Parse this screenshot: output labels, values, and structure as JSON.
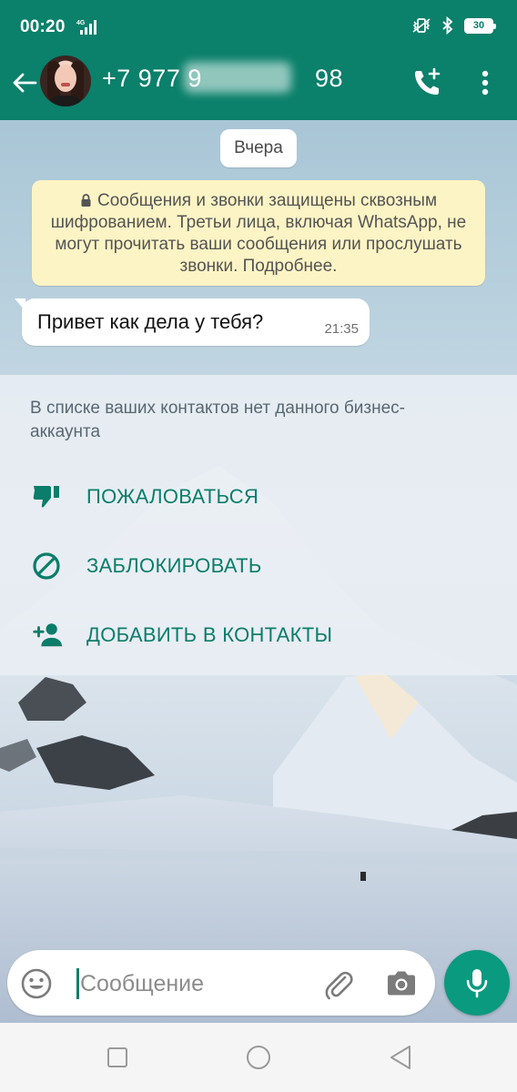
{
  "status_bar": {
    "time": "00:20",
    "network": "4G",
    "battery": "30"
  },
  "header": {
    "contact_name": "+7 977 9        98",
    "icons": [
      "back-arrow-icon",
      "avatar",
      "call-add-icon",
      "more-vert-icon"
    ]
  },
  "chat": {
    "date_chip": "Вчера",
    "encryption_notice": "Сообщения и звонки защищены сквозным шифрованием. Третьи лица, включая WhatsApp, не могут прочитать ваши сообщения или прослушать звонки. Подробнее.",
    "messages": [
      {
        "text": "Привет как дела у тебя?",
        "time": "21:35",
        "direction": "incoming"
      }
    ]
  },
  "unknown_contact": {
    "notice": "В списке ваших контактов нет данного бизнес-аккаунта",
    "actions": [
      {
        "label": "ПОЖАЛОВАТЬСЯ",
        "icon": "thumb-down-icon"
      },
      {
        "label": "ЗАБЛОКИРОВАТЬ",
        "icon": "block-icon"
      },
      {
        "label": "ДОБАВИТЬ В КОНТАКТЫ",
        "icon": "person-add-icon"
      }
    ]
  },
  "composer": {
    "placeholder": "Сообщение",
    "value": ""
  },
  "colors": {
    "header_green": "#0b806b",
    "accent_green": "#0b7d6a",
    "fab_green": "#0a9a7f",
    "notice_yellow": "#fdf4c5"
  }
}
